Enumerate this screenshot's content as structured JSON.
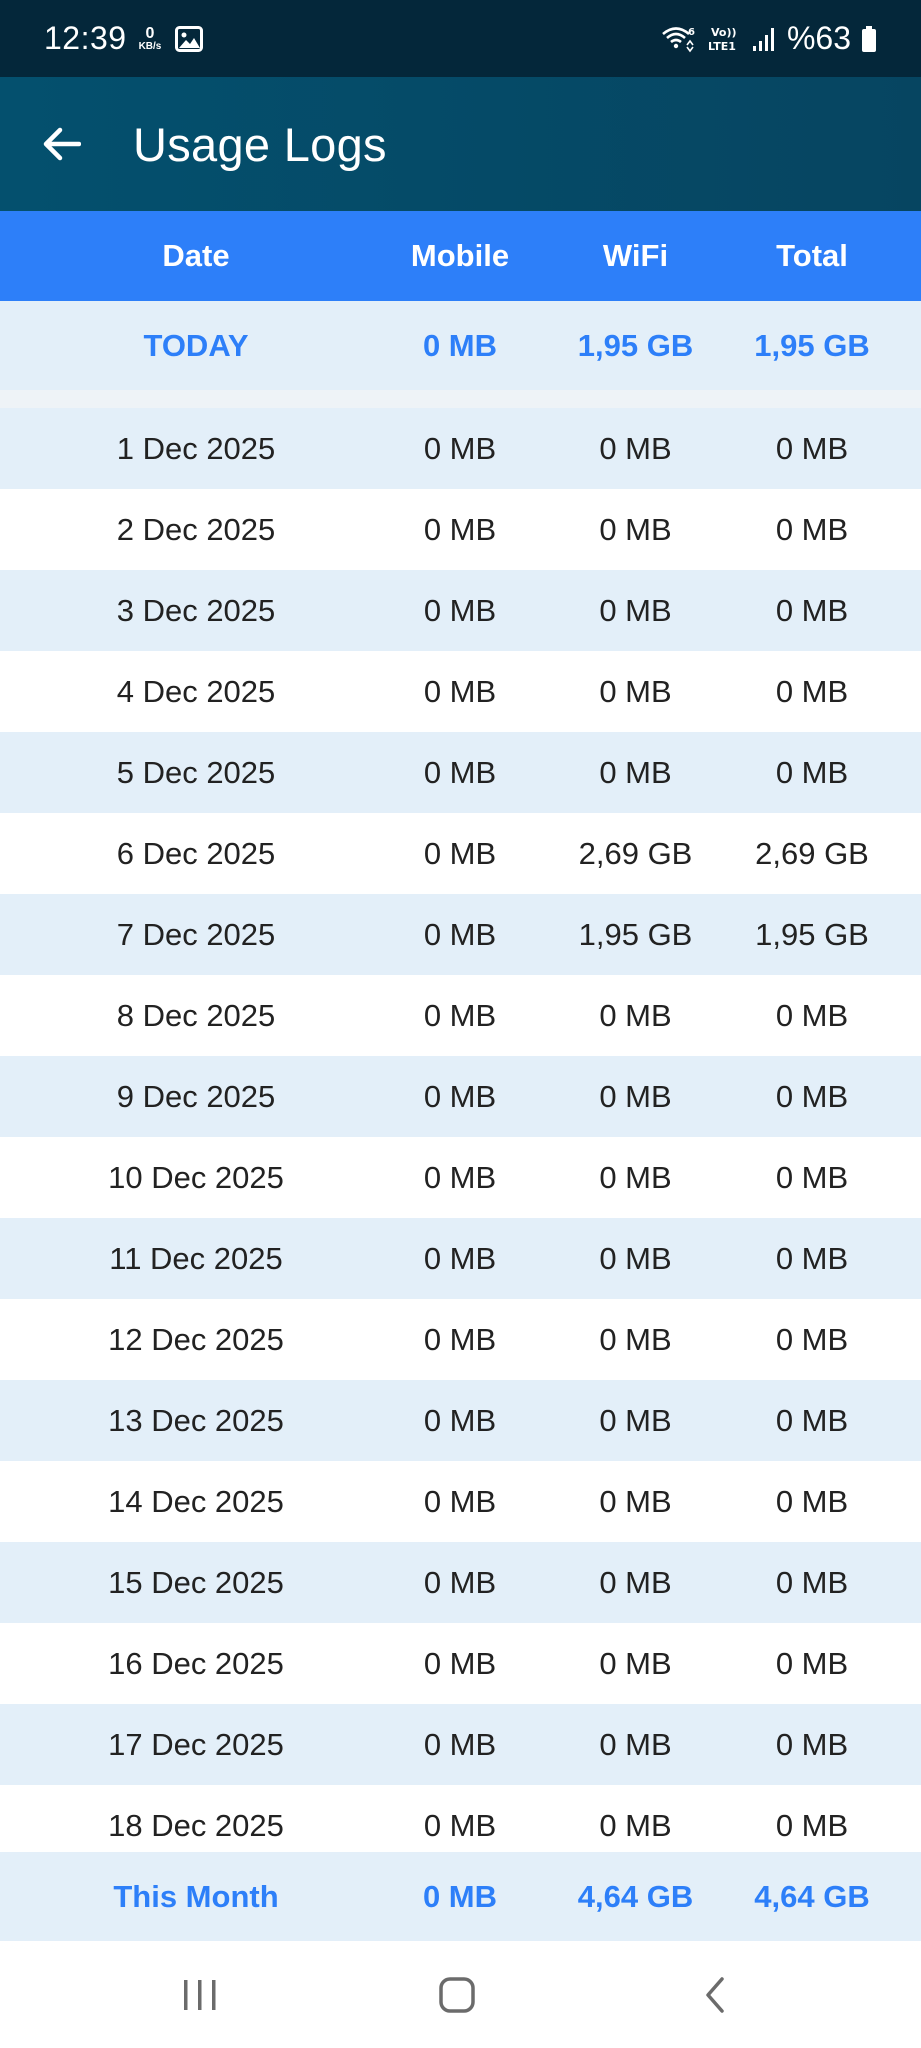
{
  "status_bar": {
    "time": "12:39",
    "net_speed_value": "0",
    "net_speed_unit": "KB/s",
    "battery": "%63"
  },
  "app_bar": {
    "title": "Usage Logs",
    "back_icon": "arrow-back-icon"
  },
  "table": {
    "headers": {
      "date": "Date",
      "mobile": "Mobile",
      "wifi": "WiFi",
      "total": "Total"
    },
    "today": {
      "date": "TODAY",
      "mobile": "0 MB",
      "wifi": "1,95 GB",
      "total": "1,95 GB"
    },
    "rows": [
      {
        "date": "1 Dec 2025",
        "mobile": "0 MB",
        "wifi": "0 MB",
        "total": "0 MB"
      },
      {
        "date": "2 Dec 2025",
        "mobile": "0 MB",
        "wifi": "0 MB",
        "total": "0 MB"
      },
      {
        "date": "3 Dec 2025",
        "mobile": "0 MB",
        "wifi": "0 MB",
        "total": "0 MB"
      },
      {
        "date": "4 Dec 2025",
        "mobile": "0 MB",
        "wifi": "0 MB",
        "total": "0 MB"
      },
      {
        "date": "5 Dec 2025",
        "mobile": "0 MB",
        "wifi": "0 MB",
        "total": "0 MB"
      },
      {
        "date": "6 Dec 2025",
        "mobile": "0 MB",
        "wifi": "2,69 GB",
        "total": "2,69 GB"
      },
      {
        "date": "7 Dec 2025",
        "mobile": "0 MB",
        "wifi": "1,95 GB",
        "total": "1,95 GB"
      },
      {
        "date": "8 Dec 2025",
        "mobile": "0 MB",
        "wifi": "0 MB",
        "total": "0 MB"
      },
      {
        "date": "9 Dec 2025",
        "mobile": "0 MB",
        "wifi": "0 MB",
        "total": "0 MB"
      },
      {
        "date": "10 Dec 2025",
        "mobile": "0 MB",
        "wifi": "0 MB",
        "total": "0 MB"
      },
      {
        "date": "11 Dec 2025",
        "mobile": "0 MB",
        "wifi": "0 MB",
        "total": "0 MB"
      },
      {
        "date": "12 Dec 2025",
        "mobile": "0 MB",
        "wifi": "0 MB",
        "total": "0 MB"
      },
      {
        "date": "13 Dec 2025",
        "mobile": "0 MB",
        "wifi": "0 MB",
        "total": "0 MB"
      },
      {
        "date": "14 Dec 2025",
        "mobile": "0 MB",
        "wifi": "0 MB",
        "total": "0 MB"
      },
      {
        "date": "15 Dec 2025",
        "mobile": "0 MB",
        "wifi": "0 MB",
        "total": "0 MB"
      },
      {
        "date": "16 Dec 2025",
        "mobile": "0 MB",
        "wifi": "0 MB",
        "total": "0 MB"
      },
      {
        "date": "17 Dec 2025",
        "mobile": "0 MB",
        "wifi": "0 MB",
        "total": "0 MB"
      },
      {
        "date": "18 Dec 2025",
        "mobile": "0 MB",
        "wifi": "0 MB",
        "total": "0 MB"
      }
    ],
    "month": {
      "date": "This Month",
      "mobile": "0 MB",
      "wifi": "4,64 GB",
      "total": "4,64 GB"
    }
  },
  "nav_bar": {
    "recents_icon": "recents-icon",
    "home_icon": "home-icon",
    "back_icon": "nav-back-icon"
  },
  "colors": {
    "status_bar": "#04273a",
    "app_bar": "#04506e",
    "header": "#2d7ff9",
    "accent_text": "#2d7ff9",
    "row_alt": "#e3eff9"
  }
}
